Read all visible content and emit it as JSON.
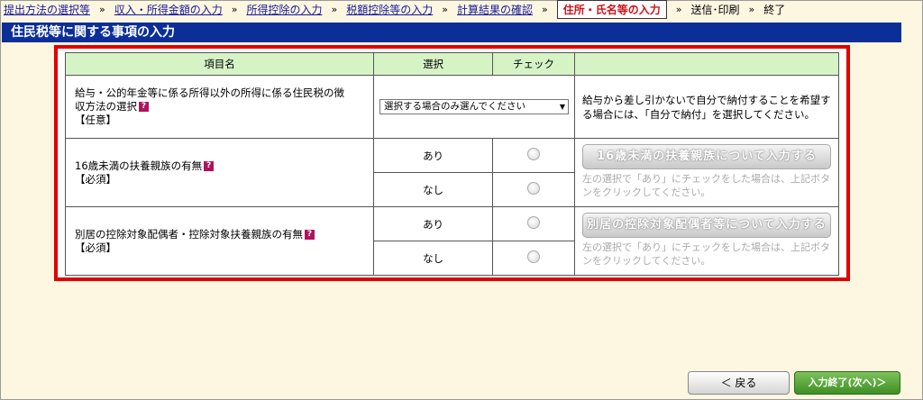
{
  "breadcrumb": {
    "steps": [
      {
        "label": "提出方法の選択等"
      },
      {
        "label": "収入・所得金額の入力"
      },
      {
        "label": "所得控除の入力"
      },
      {
        "label": "税額控除等の入力"
      },
      {
        "label": "計算結果の確認"
      },
      {
        "label": "住所・氏名等の入力"
      },
      {
        "label": "送信･印刷"
      },
      {
        "label": "終了"
      }
    ],
    "separator": "»"
  },
  "page_title": "住民税等に関する事項の入力",
  "table": {
    "headers": [
      "項目名",
      "選択",
      "チェック",
      ""
    ],
    "rows": [
      {
        "item_line1": "給与・公的年金等に係る所得以外の所得に係る住民税の徴",
        "item_line2": "収方法の選択",
        "item_tag": "【任意】",
        "select_value": "選択する場合のみ選んでください",
        "note": "給与から差し引かないで自分で納付することを希望する場合には、「自分で納付」を選択してください。"
      },
      {
        "item_line1": "16歳未満の扶養親族の有無",
        "item_tag": "【必須】",
        "option_yes": "あり",
        "option_no": "なし",
        "button": "16歳未満の扶養親族について入力する",
        "note": "左の選択で「あり」にチェックをした場合は、上記ボタンをクリックしてください。"
      },
      {
        "item_line1": "別居の控除対象配偶者・控除対象扶養親族の有無",
        "item_tag": "【必須】",
        "option_yes": "あり",
        "option_no": "なし",
        "button": "別居の控除対象配偶者等について入力する",
        "note": "左の選択で「あり」にチェックをした場合は、上記ボタンをクリックしてください。"
      }
    ],
    "help_icon": "?"
  },
  "footer": {
    "back_label": "＜ 戻る",
    "next_label": "入力終了(次へ)＞"
  },
  "colors": {
    "title_bg": "#0b2e98",
    "highlight_border": "#e00000",
    "header_bg": "#d6f3c6",
    "page_bg": "#fdf6e0",
    "next_button": "#3f8f25"
  }
}
